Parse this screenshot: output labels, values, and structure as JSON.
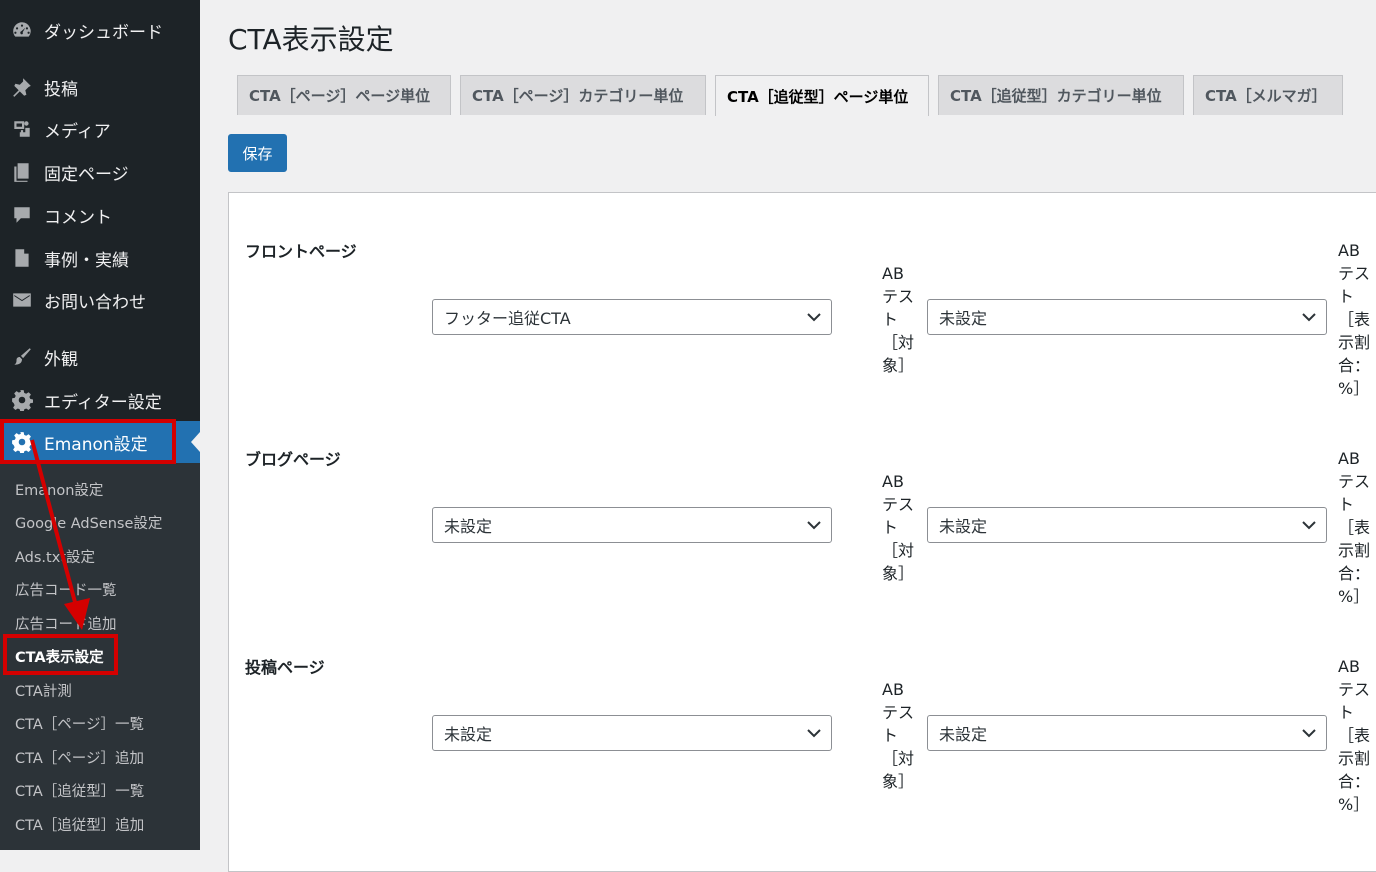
{
  "sidebar": {
    "menu": [
      {
        "label": "ダッシュボード",
        "icon": "dashboard-icon"
      },
      {
        "label": "投稿",
        "icon": "pushpin-icon"
      },
      {
        "label": "メディア",
        "icon": "media-icon"
      },
      {
        "label": "固定ページ",
        "icon": "pages-icon"
      },
      {
        "label": "コメント",
        "icon": "comment-icon"
      },
      {
        "label": "事例・実績",
        "icon": "document-icon"
      },
      {
        "label": "お問い合わせ",
        "icon": "envelope-icon"
      },
      {
        "label": "外観",
        "icon": "paintbrush-icon"
      },
      {
        "label": "エディター設定",
        "icon": "gear-icon"
      },
      {
        "label": "Emanon設定",
        "icon": "gear-icon"
      }
    ],
    "submenu": [
      "Emanon設定",
      "Google AdSense設定",
      "Ads.txt設定",
      "広告コード一覧",
      "広告コード追加",
      "CTA表示設定",
      "CTA計測",
      "CTA［ページ］一覧",
      "CTA［ページ］追加",
      "CTA［追従型］一覧",
      "CTA［追従型］追加"
    ]
  },
  "page": {
    "title": "CTA表示設定",
    "tabs": [
      "CTA［ページ］ページ単位",
      "CTA［ページ］カテゴリー単位",
      "CTA［追従型］ページ単位",
      "CTA［追従型］カテゴリー単位",
      "CTA［メルマガ］"
    ],
    "active_tab": "CTA［追従型］ページ単位",
    "save_label": "保存",
    "rows": [
      {
        "label": "フロントページ",
        "target_value": "フッター追従CTA",
        "ab_target_label": "ABテスト［対象］",
        "ab_value": "未設定",
        "ab_ratio_label": "ABテスト［表示割合：%］"
      },
      {
        "label": "ブログページ",
        "target_value": "未設定",
        "ab_target_label": "ABテスト［対象］",
        "ab_value": "未設定",
        "ab_ratio_label": "ABテスト［表示割合：%］"
      },
      {
        "label": "投稿ページ",
        "target_value": "未設定",
        "ab_target_label": "ABテスト［対象］",
        "ab_value": "未設定",
        "ab_ratio_label": "ABテスト［表示割合：%］"
      }
    ]
  },
  "colors": {
    "sidebar_bg": "#1d2327",
    "submenu_bg": "#2c3338",
    "accent": "#2271b1",
    "annotation": "#d40000"
  }
}
